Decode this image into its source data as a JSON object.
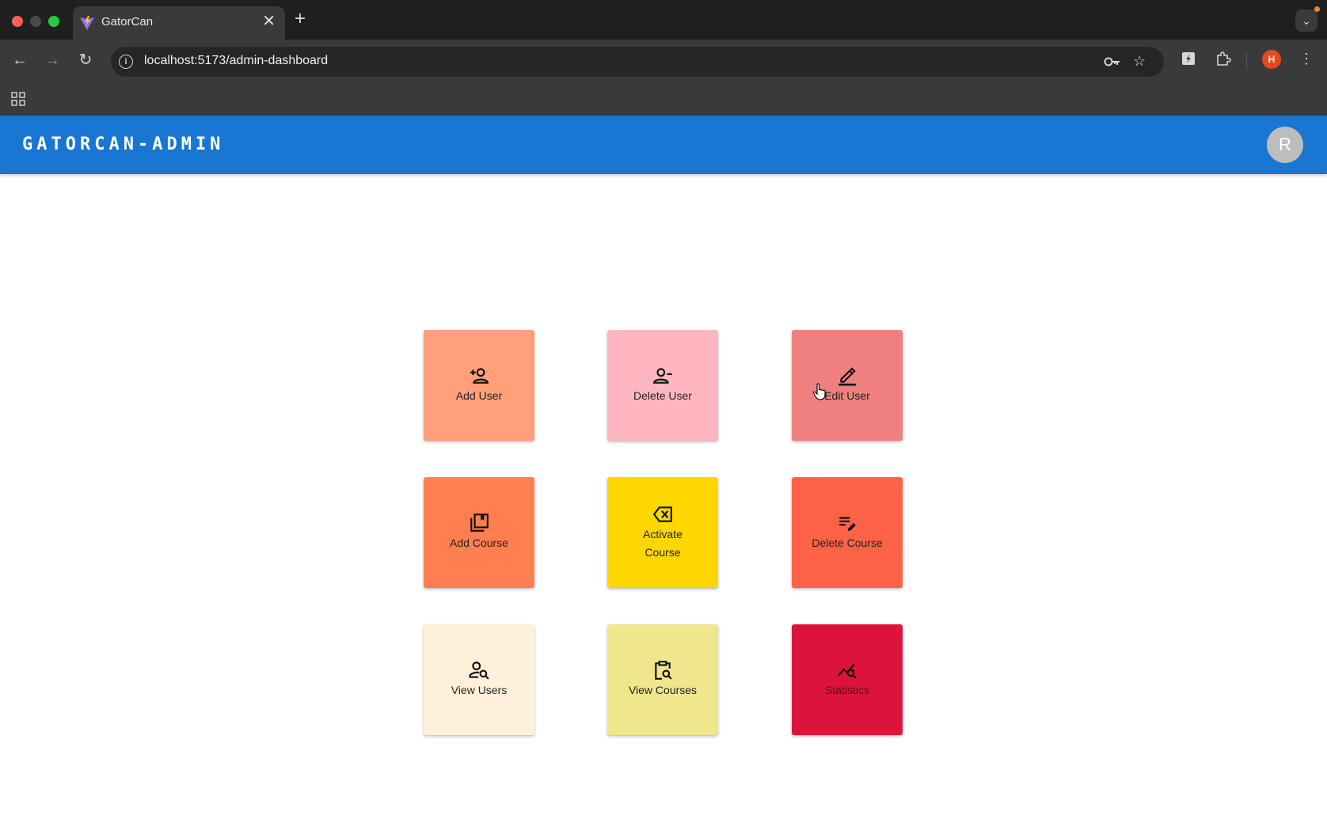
{
  "browser": {
    "tab_title": "GatorCan",
    "url": "localhost:5173/admin-dashboard",
    "new_tab_glyph": "+",
    "close_glyph": "✕",
    "profile_initial": "H"
  },
  "app": {
    "brand": "GATORCAN-ADMIN",
    "avatar_initial": "R",
    "header_color": "#1976d2"
  },
  "tiles": [
    {
      "label": "Add User",
      "icon": "person-add-icon",
      "color": "#ffa07a"
    },
    {
      "label": "Delete User",
      "icon": "person-remove-icon",
      "color": "#ffb6c1"
    },
    {
      "label": "Edit User",
      "icon": "edit-icon",
      "color": "#f08080"
    },
    {
      "label": "Add Course",
      "icon": "library-add-icon",
      "color": "#ff7f50"
    },
    {
      "label": "Activate Course",
      "icon": "backspace-icon",
      "color": "#ffd700"
    },
    {
      "label": "Delete Course",
      "icon": "edit-note-icon",
      "color": "#ff6347"
    },
    {
      "label": "View Users",
      "icon": "person-search-icon",
      "color": "#fff1d9"
    },
    {
      "label": "View Courses",
      "icon": "content-paste-search-icon",
      "color": "#f0e68c"
    },
    {
      "label": "Statistics",
      "icon": "query-stats-icon",
      "color": "#dc143c"
    }
  ]
}
